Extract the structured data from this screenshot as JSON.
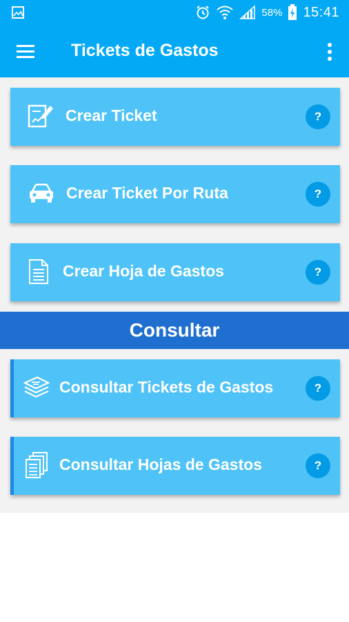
{
  "status_bar": {
    "battery_percent": "58%",
    "time": "15:41",
    "icons": [
      "gallery-icon",
      "alarm-icon",
      "wifi-icon",
      "signal-icon",
      "battery-charging-icon"
    ]
  },
  "app_bar": {
    "title": "Tickets de Gastos",
    "menu_icon": "hamburger-menu-icon",
    "more_icon": "more-vertical-icon"
  },
  "actions": [
    {
      "label": "Crear Ticket",
      "icon": "edit-document-icon",
      "help": "?"
    },
    {
      "label": "Crear Ticket Por Ruta",
      "icon": "car-icon",
      "help": "?"
    },
    {
      "label": "Crear Hoja de Gastos",
      "icon": "document-icon",
      "help": "?"
    }
  ],
  "section": {
    "title": "Consultar"
  },
  "queries": [
    {
      "label": "Consultar Tickets de Gastos",
      "icon": "stacked-tickets-icon",
      "help": "?"
    },
    {
      "label": "Consultar Hojas de Gastos",
      "icon": "stacked-documents-icon",
      "help": "?"
    }
  ],
  "colors": {
    "primary": "#03a9f4",
    "card": "#4fc3f7",
    "section": "#1e6fcf",
    "help_badge": "#039be5"
  }
}
